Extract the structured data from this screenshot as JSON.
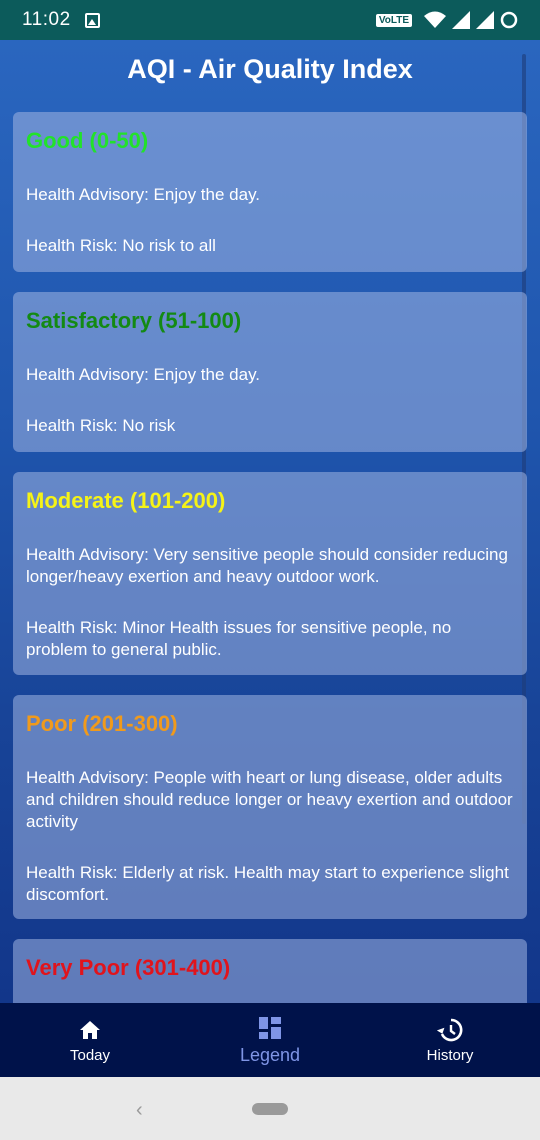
{
  "status_bar": {
    "time": "11:02",
    "volte": "VoLTE",
    "icons": [
      "image-icon",
      "volte-icon",
      "wifi-icon",
      "signal-icon",
      "signal-icon-2",
      "circle-icon"
    ]
  },
  "header": {
    "title": "AQI - Air Quality Index"
  },
  "cards": [
    {
      "title": "Good (0-50)",
      "color": "#22e22a",
      "advisory": "Health Advisory: Enjoy the day.",
      "risk": "Health Risk: No risk to all"
    },
    {
      "title": "Satisfactory (51-100)",
      "color": "#138a13",
      "advisory": "Health Advisory: Enjoy the day.",
      "risk": "Health Risk: No risk"
    },
    {
      "title": "Moderate (101-200)",
      "color": "#f5f317",
      "advisory": "Health Advisory: Very sensitive people should consider reducing longer/heavy exertion and heavy outdoor work.",
      "risk": "Health Risk: Minor Health issues for sensitive people, no problem to general public."
    },
    {
      "title": "Poor (201-300)",
      "color": "#f09a1c",
      "advisory": "Health Advisory: People with heart or lung disease, older adults and children should reduce longer or heavy exertion and outdoor activity",
      "risk": "Health Risk: Elderly at risk. Health may start to experience slight discomfort."
    },
    {
      "title": "Very Poor (301-400)",
      "color": "#e0141c"
    }
  ],
  "bottom_nav": {
    "items": [
      {
        "label": "Today",
        "icon": "home-icon"
      },
      {
        "label": "Legend",
        "icon": "dashboard-icon",
        "active": true
      },
      {
        "label": "History",
        "icon": "history-icon"
      }
    ],
    "active_color": "#7f95e6"
  },
  "system_nav": {
    "back_icon": "back-icon",
    "home_icon": "home-pill-icon"
  }
}
